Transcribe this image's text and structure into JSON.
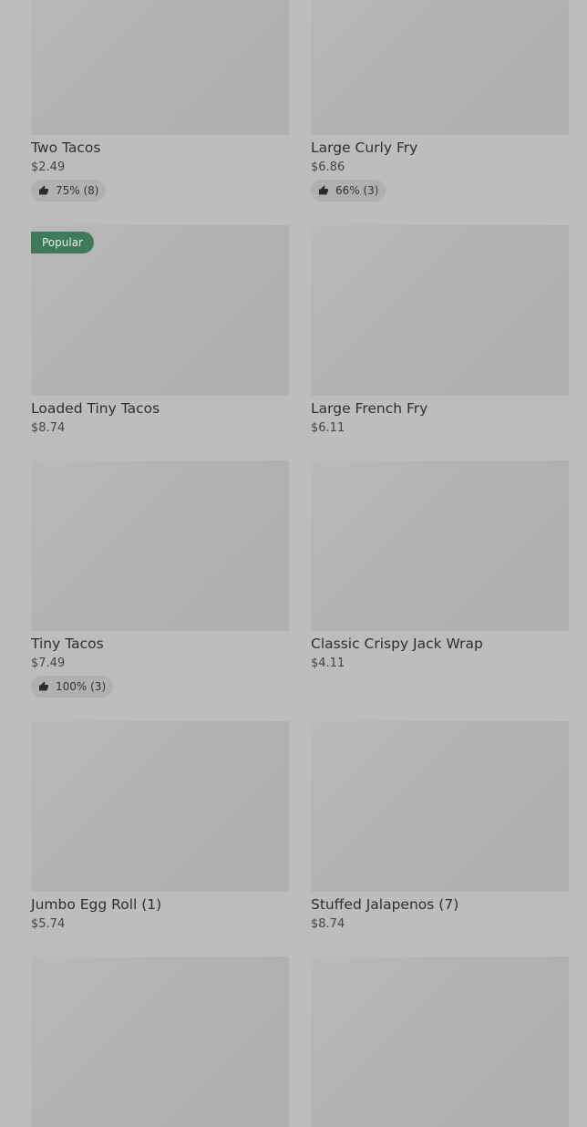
{
  "items": [
    {
      "name": "Two Tacos",
      "price": "$2.49",
      "rating": "75% (8)"
    },
    {
      "name": "Large Curly Fry",
      "price": "$6.86",
      "rating": "66% (3)"
    },
    {
      "name": "Loaded Tiny Tacos",
      "price": "$8.74",
      "badge": "Popular"
    },
    {
      "name": "Large French Fry",
      "price": "$6.11"
    },
    {
      "name": "Tiny Tacos",
      "price": "$7.49",
      "rating": "100% (3)"
    },
    {
      "name": "Classic Crispy Jack Wrap",
      "price": "$4.11"
    },
    {
      "name": "Jumbo Egg Roll (1)",
      "price": "$5.74"
    },
    {
      "name": "Stuffed Jalapenos (7)",
      "price": "$8.74"
    },
    {
      "name": "",
      "price": ""
    },
    {
      "name": "",
      "price": ""
    }
  ],
  "icons": {
    "rating": "thumbs-up-icon"
  },
  "colors": {
    "popular_badge": "#3f7a5a",
    "background": "#bdbdbd"
  }
}
